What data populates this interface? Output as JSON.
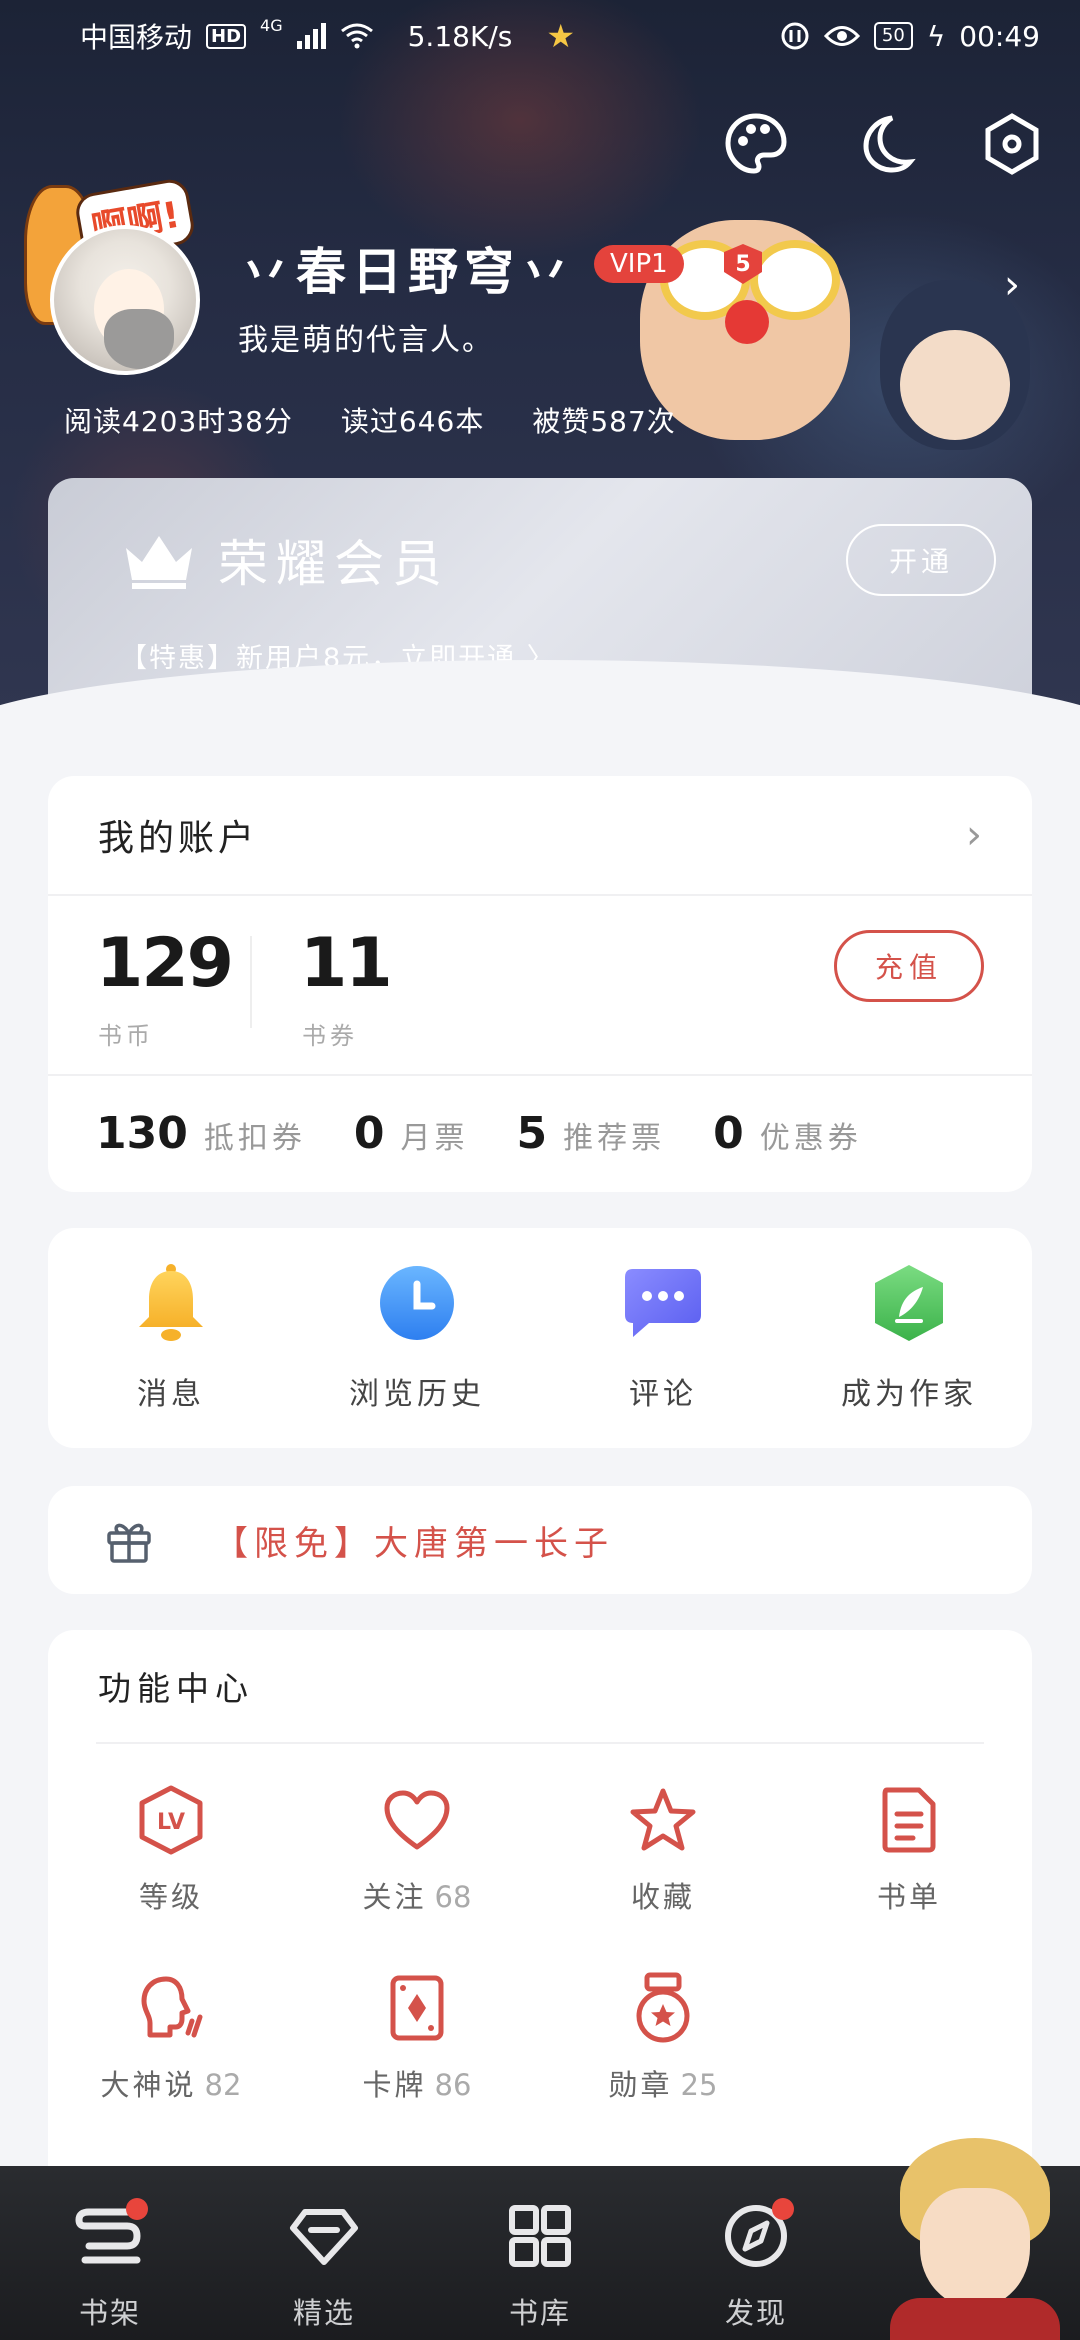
{
  "status_bar": {
    "carrier": "中国移动",
    "hd": "HD",
    "network": "4G",
    "speed": "5.18K/s",
    "battery": "50",
    "time": "00:49"
  },
  "header": {
    "username": "丷春日野穹丷",
    "vip_label": "VIP1",
    "level": "5",
    "bio": "我是萌的代言人。",
    "chicken_bubble": "啊啊!",
    "stats": [
      {
        "label": "阅读4203时38分"
      },
      {
        "label": "读过646本"
      },
      {
        "label": "被赞587次"
      }
    ]
  },
  "vip_card": {
    "title": "荣耀会员",
    "open_button": "开通",
    "promo": "【特惠】新用户8元，立即开通 〉"
  },
  "account": {
    "title": "我的账户",
    "coins_value": "129",
    "coins_label": "书币",
    "vouchers_value": "11",
    "vouchers_label": "书券",
    "recharge_button": "充值",
    "tickets": [
      {
        "value": "130",
        "label": "抵扣券"
      },
      {
        "value": "0",
        "label": "月票"
      },
      {
        "value": "5",
        "label": "推荐票"
      },
      {
        "value": "0",
        "label": "优惠券"
      }
    ]
  },
  "quick_actions": [
    {
      "label": "消息",
      "icon": "bell-icon"
    },
    {
      "label": "浏览历史",
      "icon": "clock-icon"
    },
    {
      "label": "评论",
      "icon": "chat-bubble-icon"
    },
    {
      "label": "成为作家",
      "icon": "pen-leaf-icon"
    }
  ],
  "promo_banner": {
    "text": "【限免】大唐第一长子"
  },
  "function_center": {
    "title": "功能中心",
    "items": [
      {
        "label": "等级",
        "count": "",
        "icon": "level-badge-icon"
      },
      {
        "label": "关注",
        "count": "68",
        "icon": "heart-icon"
      },
      {
        "label": "收藏",
        "count": "",
        "icon": "star-icon"
      },
      {
        "label": "书单",
        "count": "",
        "icon": "booklist-icon"
      },
      {
        "label": "大神说",
        "count": "82",
        "icon": "speaking-head-icon"
      },
      {
        "label": "卡牌",
        "count": "86",
        "icon": "card-icon"
      },
      {
        "label": "勋章",
        "count": "25",
        "icon": "medal-icon"
      }
    ]
  },
  "tabbar": {
    "items": [
      {
        "label": "书架",
        "icon": "bookshelf-icon",
        "dot": true
      },
      {
        "label": "精选",
        "icon": "diamond-icon",
        "dot": false
      },
      {
        "label": "书库",
        "icon": "grid-icon",
        "dot": false
      },
      {
        "label": "发现",
        "icon": "compass-icon",
        "dot": true
      }
    ]
  },
  "colors": {
    "accent_red": "#d4524a",
    "header_bg": "#252c44",
    "page_bg": "#f4f5f8",
    "tabbar_bg": "#1b1c1f"
  }
}
